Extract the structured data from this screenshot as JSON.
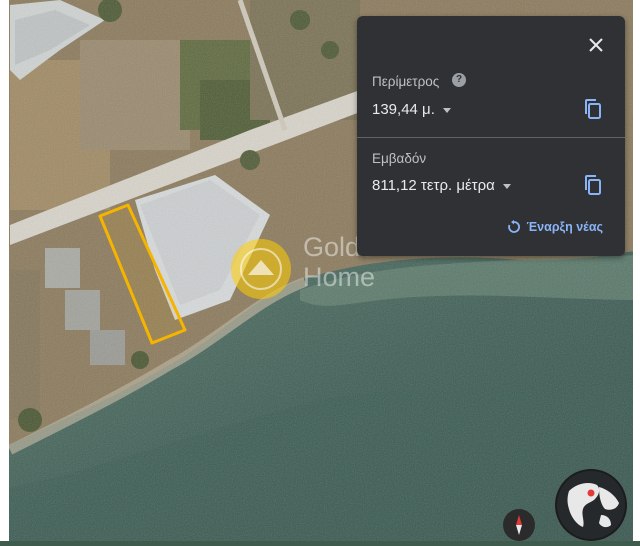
{
  "measure_panel": {
    "perimeter_label": "Περίμετρος",
    "perimeter_value": "139,44 μ.",
    "area_label": "Εμβαδόν",
    "area_value": "811,12 τετρ. μέτρα",
    "restart_label": "Έναρξη νέας"
  },
  "watermark": {
    "line1": "Golden",
    "line2": "Home"
  },
  "icons": {
    "close": "close-icon",
    "help": "help-icon",
    "copy": "copy-icon",
    "restart": "restart-icon",
    "compass": "compass-icon",
    "globe": "globe-icon"
  },
  "colors": {
    "panel_bg": "#303134",
    "accent_blue": "#8ab4f8",
    "polygon_outline": "#f5b400"
  }
}
